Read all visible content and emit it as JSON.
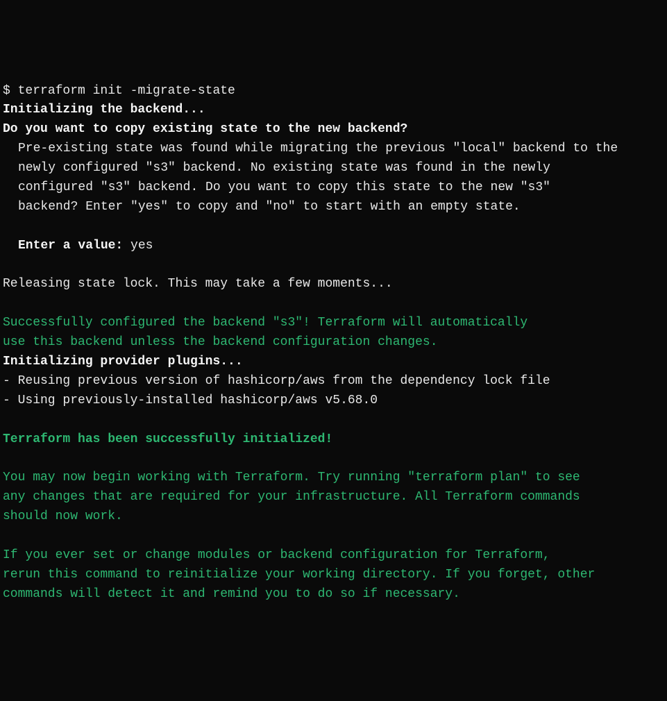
{
  "terminal": {
    "prompt": "$ ",
    "command": "terraform init -migrate-state",
    "init_backend": "Initializing the backend...",
    "copy_question": "Do you want to copy existing state to the new backend?",
    "pre_existing_1": "Pre-existing state was found while migrating the previous \"local\" backend to the",
    "pre_existing_2": "newly configured \"s3\" backend. No existing state was found in the newly",
    "pre_existing_3": "configured \"s3\" backend. Do you want to copy this state to the new \"s3\"",
    "pre_existing_4": "backend? Enter \"yes\" to copy and \"no\" to start with an empty state.",
    "enter_value_label": "Enter a value: ",
    "enter_value_input": "yes",
    "releasing": "Releasing state lock. This may take a few moments...",
    "success_s3_1": "Successfully configured the backend \"s3\"! Terraform will automatically",
    "success_s3_2": "use this backend unless the backend configuration changes.",
    "init_plugins": "Initializing provider plugins...",
    "reusing": "- Reusing previous version of hashicorp/aws from the dependency lock file",
    "using": "- Using previously-installed hashicorp/aws v5.68.0",
    "tf_success": "Terraform has been successfully initialized!",
    "begin_1": "You may now begin working with Terraform. Try running \"terraform plan\" to see",
    "begin_2": "any changes that are required for your infrastructure. All Terraform commands",
    "begin_3": "should now work.",
    "rerun_1": "If you ever set or change modules or backend configuration for Terraform,",
    "rerun_2": "rerun this command to reinitialize your working directory. If you forget, other",
    "rerun_3": "commands will detect it and remind you to do so if necessary."
  }
}
